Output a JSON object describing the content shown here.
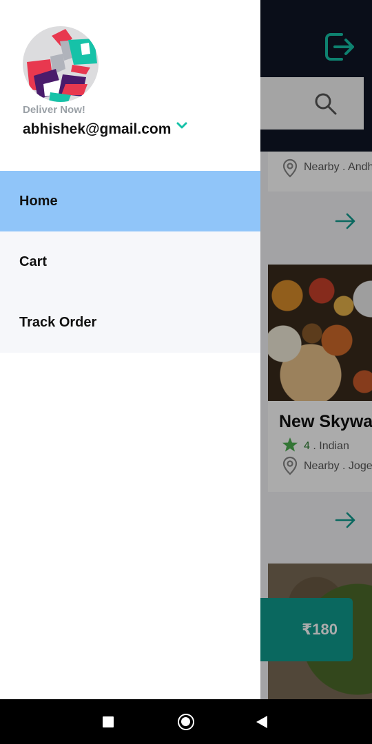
{
  "background_app": {
    "nearby_text_1": "Nearby . Andh",
    "restaurant_name": "New Skyway",
    "rating": "4",
    "cuisine": ". Indian",
    "nearby_text_2": "Nearby . Joge",
    "price": "₹180"
  },
  "drawer": {
    "tagline": "Deliver Now!",
    "email": "abhishek@gmail.com",
    "menu": [
      {
        "label": "Home",
        "active": true
      },
      {
        "label": "Cart",
        "active": false
      },
      {
        "label": "Track Order",
        "active": false
      }
    ]
  },
  "colors": {
    "accent": "#0f9b8e",
    "active_menu_bg": "#90c5f9",
    "chevron": "#16c2a8"
  },
  "icons": [
    "logout-icon",
    "search-icon",
    "location-pin-icon",
    "arrow-right-icon",
    "star-icon",
    "chevron-down-icon",
    "nav-recents-icon",
    "nav-home-icon",
    "nav-back-icon"
  ]
}
